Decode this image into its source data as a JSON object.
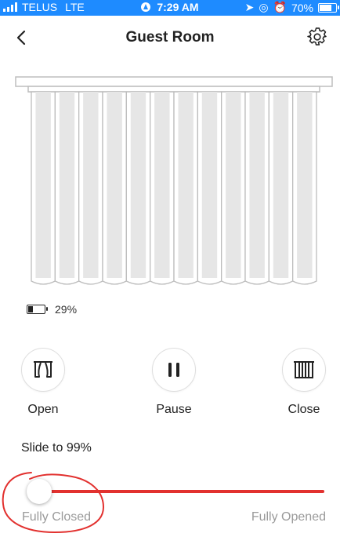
{
  "status_bar": {
    "carrier": "TELUS",
    "network": "LTE",
    "time": "7:29 AM",
    "battery_percent_text": "70%",
    "background_color": "#1e8bff"
  },
  "header": {
    "title": "Guest Room",
    "back_icon": "chevron-left-icon",
    "settings_icon": "gear-icon"
  },
  "device": {
    "battery_percent": 29,
    "battery_text": "29%",
    "panel_count": 12
  },
  "controls": {
    "open_label": "Open",
    "pause_label": "Pause",
    "close_label": "Close"
  },
  "slider": {
    "label": "Slide to 99%",
    "value_fraction": 0.0,
    "min_label": "Fully Closed",
    "max_label": "Fully Opened",
    "track_color": "#e2312f"
  }
}
